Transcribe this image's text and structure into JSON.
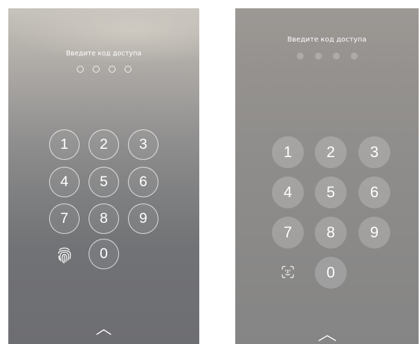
{
  "screens": [
    {
      "id": "left",
      "prompt": "Введите код доступа",
      "dot_count": 4,
      "dot_style": "outlined",
      "keys": [
        "1",
        "2",
        "3",
        "4",
        "5",
        "6",
        "7",
        "8",
        "9",
        "0"
      ],
      "biometric_icon": "fingerprint-icon",
      "bottom_icon": "chevron-up-icon"
    },
    {
      "id": "right",
      "prompt": "Введите код доступа",
      "dot_count": 4,
      "dot_style": "filled",
      "keys": [
        "1",
        "2",
        "3",
        "4",
        "5",
        "6",
        "7",
        "8",
        "9",
        "0"
      ],
      "biometric_icon": "face-id-icon",
      "bottom_icon": "chevron-up-icon"
    }
  ],
  "colors": {
    "text": "#ffffff",
    "left_background_top": "#c7c3bd",
    "left_background_bottom": "#6d6e72",
    "right_background": "#8f8d8b"
  }
}
